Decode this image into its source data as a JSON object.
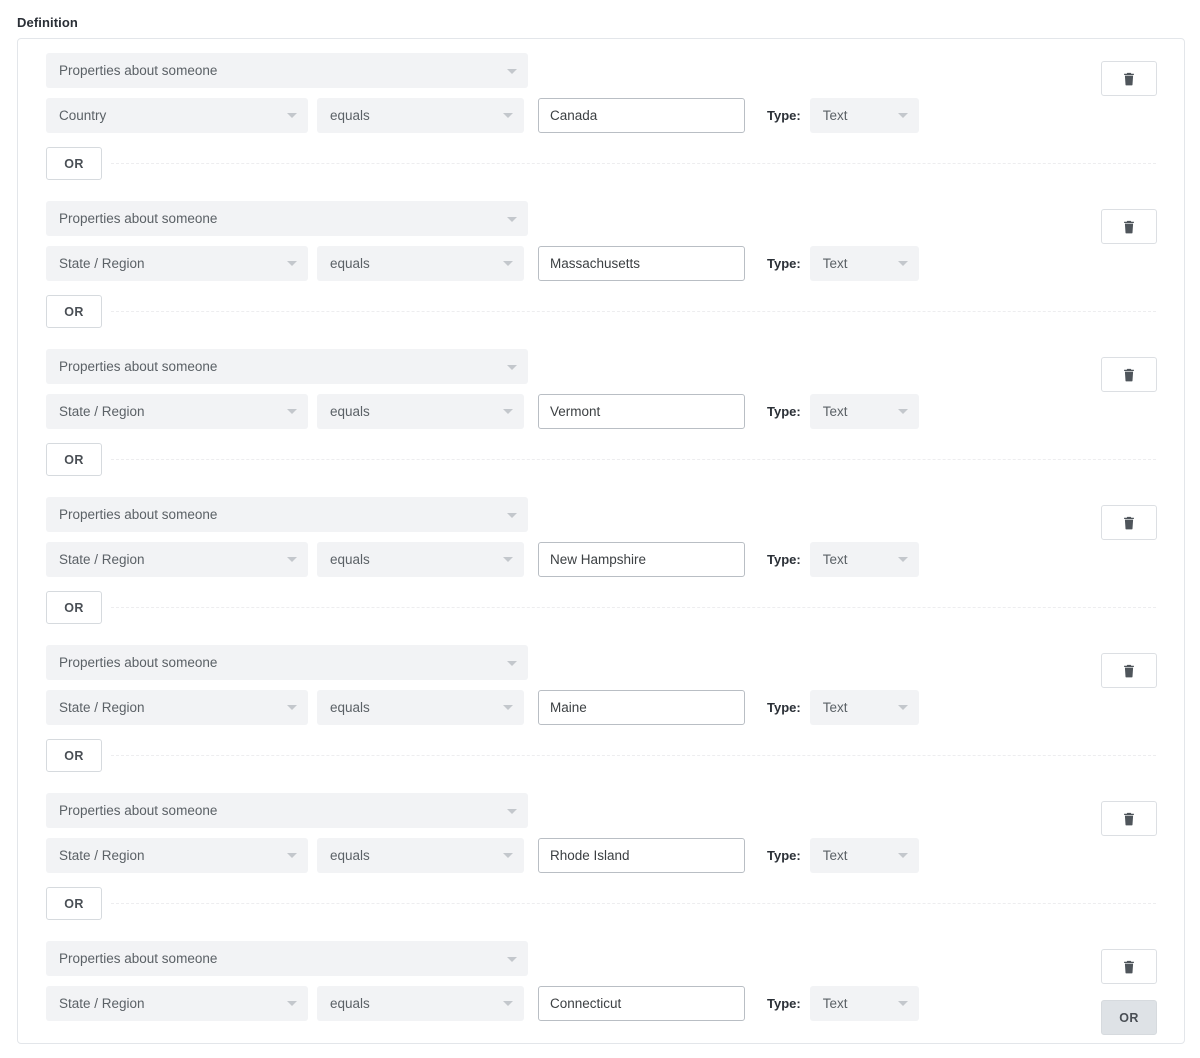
{
  "page": {
    "definition_label": "Definition"
  },
  "labels": {
    "type_label": "Type:",
    "or_label": "OR",
    "delete_icon": "trash-icon"
  },
  "colors": {
    "select_bg": "#f2f3f5",
    "select_text": "#5b6166",
    "border": "#e3e6ea",
    "input_border": "#b9bec4",
    "or_active_bg": "#dee2e6",
    "dashed_line": "#ededef",
    "heading_text": "#2a2f36"
  },
  "groups": [
    {
      "entity": "Properties about someone",
      "field": "Country",
      "operator": "equals",
      "value": "Canada",
      "type": "Text",
      "or_position": "left"
    },
    {
      "entity": "Properties about someone",
      "field": "State / Region",
      "operator": "equals",
      "value": "Massachusetts",
      "type": "Text",
      "or_position": "left"
    },
    {
      "entity": "Properties about someone",
      "field": "State / Region",
      "operator": "equals",
      "value": "Vermont",
      "type": "Text",
      "or_position": "left"
    },
    {
      "entity": "Properties about someone",
      "field": "State / Region",
      "operator": "equals",
      "value": "New Hampshire",
      "type": "Text",
      "or_position": "left"
    },
    {
      "entity": "Properties about someone",
      "field": "State / Region",
      "operator": "equals",
      "value": "Maine",
      "type": "Text",
      "or_position": "left"
    },
    {
      "entity": "Properties about someone",
      "field": "State / Region",
      "operator": "equals",
      "value": "Rhode Island",
      "type": "Text",
      "or_position": "left"
    },
    {
      "entity": "Properties about someone",
      "field": "State / Region",
      "operator": "equals",
      "value": "Connecticut",
      "type": "Text",
      "or_position": "right"
    }
  ]
}
